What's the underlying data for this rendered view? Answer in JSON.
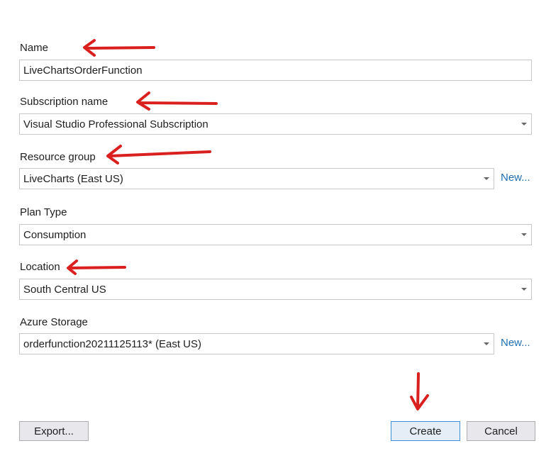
{
  "name": {
    "label": "Name",
    "value": "LiveChartsOrderFunction"
  },
  "subscription": {
    "label": "Subscription name",
    "value": "Visual Studio Professional Subscription"
  },
  "resource_group": {
    "label": "Resource group",
    "value": "LiveCharts (East US)",
    "new_link": "New..."
  },
  "plan_type": {
    "label": "Plan Type",
    "value": "Consumption"
  },
  "location": {
    "label": "Location",
    "value": "South Central US"
  },
  "storage": {
    "label": "Azure Storage",
    "value": "orderfunction20211125113* (East US)",
    "new_link": "New..."
  },
  "buttons": {
    "export": "Export...",
    "create": "Create",
    "cancel": "Cancel"
  },
  "colors": {
    "annotation": "#d9201f",
    "link": "#1f6fb3"
  }
}
